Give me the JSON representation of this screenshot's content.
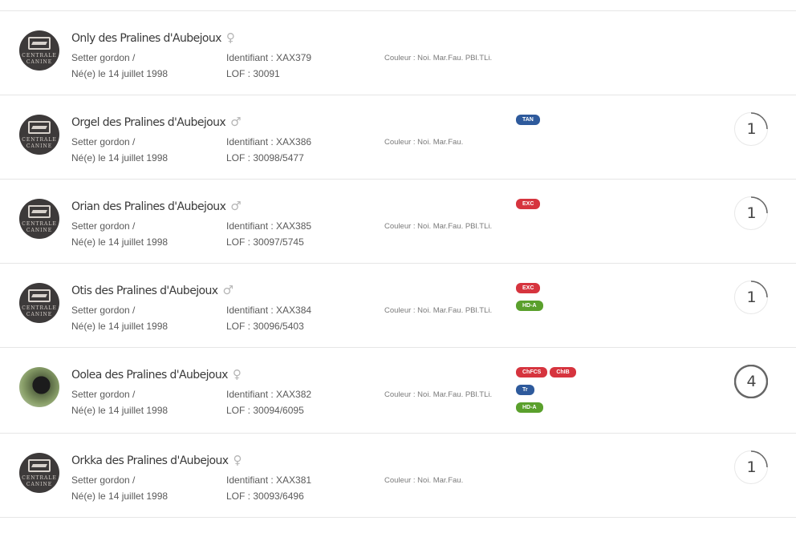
{
  "colors": {
    "accent_blue": "#2e5a9c",
    "accent_red": "#d6343e",
    "accent_green": "#5aa02c",
    "gauge": "#666666"
  },
  "logo": {
    "line1": "CENTRALE",
    "line2": "CANINE"
  },
  "dogs": [
    {
      "name": "Only des Pralines d'Aubejoux",
      "sex": "♀",
      "breed": "Setter gordon /",
      "birth": "Né(e) le 14 juillet 1998",
      "ident": "Identifiant : XAX379",
      "lof": "LOF : 30091",
      "color": "Couleur : Noi. Mar.Fau. PBl.TLi.",
      "badges": [],
      "score": "",
      "avatar": "logo"
    },
    {
      "name": "Orgel des Pralines d'Aubejoux",
      "sex": "♂",
      "breed": "Setter gordon /",
      "birth": "Né(e) le 14 juillet 1998",
      "ident": "Identifiant : XAX386",
      "lof": "LOF : 30098/5477",
      "color": "Couleur : Noi. Mar.Fau.",
      "badges": [
        {
          "label": "TAN",
          "color": "blue"
        }
      ],
      "score": "1",
      "avatar": "logo"
    },
    {
      "name": "Orian des Pralines d'Aubejoux",
      "sex": "♂",
      "breed": "Setter gordon /",
      "birth": "Né(e) le 14 juillet 1998",
      "ident": "Identifiant : XAX385",
      "lof": "LOF : 30097/5745",
      "color": "Couleur : Noi. Mar.Fau. PBl.TLi.",
      "badges": [
        {
          "label": "EXC",
          "color": "red"
        }
      ],
      "score": "1",
      "avatar": "logo"
    },
    {
      "name": "Otis des Pralines d'Aubejoux",
      "sex": "♂",
      "breed": "Setter gordon /",
      "birth": "Né(e) le 14 juillet 1998",
      "ident": "Identifiant : XAX384",
      "lof": "LOF : 30096/5403",
      "color": "Couleur : Noi. Mar.Fau. PBl.TLi.",
      "badges": [
        {
          "label": "EXC",
          "color": "red"
        },
        {
          "label": "HD-A",
          "color": "green"
        }
      ],
      "score": "1",
      "avatar": "logo"
    },
    {
      "name": "Oolea des Pralines d'Aubejoux",
      "sex": "♀",
      "breed": "Setter gordon /",
      "birth": "Né(e) le 14 juillet 1998",
      "ident": "Identifiant : XAX382",
      "lof": "LOF : 30094/6095",
      "color": "Couleur : Noi. Mar.Fau. PBl.TLi.",
      "badges": [
        {
          "label": "ChFCS",
          "color": "red"
        },
        {
          "label": "ChIB",
          "color": "red"
        },
        {
          "label": "Tr",
          "color": "blue"
        },
        {
          "label": "HD-A",
          "color": "green"
        }
      ],
      "score": "4",
      "avatar": "photo"
    },
    {
      "name": "Orkka des Pralines d'Aubejoux",
      "sex": "♀",
      "breed": "Setter gordon /",
      "birth": "Né(e) le 14 juillet 1998",
      "ident": "Identifiant : XAX381",
      "lof": "LOF : 30093/6496",
      "color": "Couleur : Noi. Mar.Fau.",
      "badges": [],
      "score": "1",
      "avatar": "logo"
    }
  ]
}
